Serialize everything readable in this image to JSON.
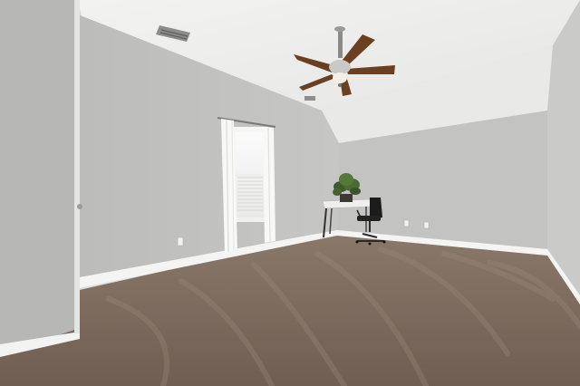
{
  "scene": {
    "subject": "empty-bedroom-interior",
    "colors": {
      "ceiling": "#eeeeec",
      "wall_left": "#b9b9b7",
      "wall_back": "#c4c4c2",
      "wall_right": "#cbcbc9",
      "carpet": "#7b6a5c",
      "trim": "#f4f4f2",
      "fan_blade": "#6b3f22"
    },
    "objects": [
      "ceiling-fan-icon",
      "window-icon",
      "desk-icon",
      "office-chair-icon",
      "potted-plant-icon",
      "door-icon",
      "air-vent-icon",
      "outlet-icon"
    ]
  }
}
